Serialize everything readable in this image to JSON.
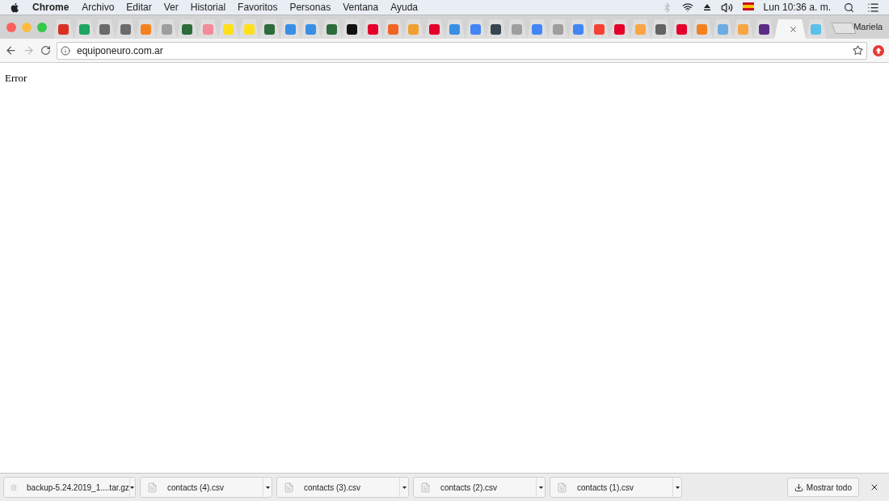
{
  "menu_bar": {
    "app": "Chrome",
    "menus": [
      "Archivo",
      "Editar",
      "Ver",
      "Historial",
      "Favoritos",
      "Personas",
      "Ventana",
      "Ayuda"
    ],
    "clock": "Lun 10:36 a. m."
  },
  "tabs": [
    {
      "color": "#d93025",
      "selected": false
    },
    {
      "color": "#1fa463",
      "selected": false
    },
    {
      "color": "#6b6b6b",
      "selected": false
    },
    {
      "color": "#6b6b6b",
      "selected": false
    },
    {
      "color": "#f48120",
      "selected": false
    },
    {
      "color": "#9e9e9e",
      "selected": false
    },
    {
      "color": "#2e6b3a",
      "selected": false
    },
    {
      "color": "#f28b9a",
      "selected": false
    },
    {
      "color": "#ffe01b",
      "selected": false
    },
    {
      "color": "#ffe01b",
      "selected": false
    },
    {
      "color": "#2e6b3a",
      "selected": false
    },
    {
      "color": "#3a8ee6",
      "selected": false
    },
    {
      "color": "#3a8ee6",
      "selected": false
    },
    {
      "color": "#2e6b3a",
      "selected": false
    },
    {
      "color": "#111111",
      "selected": false
    },
    {
      "color": "#e4002b",
      "selected": false
    },
    {
      "color": "#f26522",
      "selected": false
    },
    {
      "color": "#f0a030",
      "selected": false
    },
    {
      "color": "#e4002b",
      "selected": false
    },
    {
      "color": "#3a8ee6",
      "selected": false
    },
    {
      "color": "#4285f4",
      "selected": false
    },
    {
      "color": "#37474f",
      "selected": false
    },
    {
      "color": "#9e9e9e",
      "selected": false
    },
    {
      "color": "#4285f4",
      "selected": false
    },
    {
      "color": "#9e9e9e",
      "selected": false
    },
    {
      "color": "#4285f4",
      "selected": false
    },
    {
      "color": "#f44336",
      "selected": false
    },
    {
      "color": "#e4002b",
      "selected": false
    },
    {
      "color": "#f9a541",
      "selected": false
    },
    {
      "color": "#636363",
      "selected": false
    },
    {
      "color": "#e4002b",
      "selected": false
    },
    {
      "color": "#f48120",
      "selected": false
    },
    {
      "color": "#6cace4",
      "selected": false
    },
    {
      "color": "#f9a541",
      "selected": false
    },
    {
      "color": "#5b2c83",
      "selected": false
    },
    {
      "selected": true
    },
    {
      "color": "#5bc0eb",
      "selected": false
    }
  ],
  "profile": "Mariela",
  "address_bar": {
    "url": "equiponeuro.com.ar"
  },
  "page": {
    "text": "Error"
  },
  "downloads": {
    "items": [
      "backup-5.24.2019_1....tar.gz",
      "contacts (4).csv",
      "contacts (3).csv",
      "contacts (2).csv",
      "contacts (1).csv"
    ],
    "show_all": "Mostrar todo"
  }
}
